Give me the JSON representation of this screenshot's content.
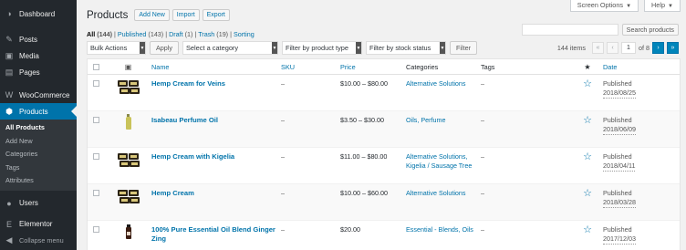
{
  "sidebar": {
    "items": [
      {
        "label": "Dashboard",
        "icon": "dashboard-icon",
        "glyph": "◑"
      },
      {
        "label": "Posts",
        "icon": "pin-icon",
        "glyph": "✎"
      },
      {
        "label": "Media",
        "icon": "media-icon",
        "glyph": "▣"
      },
      {
        "label": "Pages",
        "icon": "pages-icon",
        "glyph": "▤"
      },
      {
        "label": "WooCommerce",
        "icon": "woocommerce-icon",
        "glyph": "W"
      },
      {
        "label": "Products",
        "icon": "products-icon",
        "glyph": "⬢"
      },
      {
        "label": "Users",
        "icon": "users-icon",
        "glyph": "●"
      },
      {
        "label": "Elementor",
        "icon": "elementor-icon",
        "glyph": "E"
      },
      {
        "label": "Collapse menu",
        "icon": "collapse-icon",
        "glyph": "◀"
      }
    ],
    "submenu": [
      "All Products",
      "Add New",
      "Categories",
      "Tags",
      "Attributes"
    ]
  },
  "top_tabs": {
    "screen_options": "Screen Options",
    "help": "Help"
  },
  "header": {
    "title": "Products",
    "add_new": "Add New",
    "import": "Import",
    "export": "Export"
  },
  "views": {
    "all": "All",
    "all_count": "(144)",
    "published": "Published",
    "published_count": "(143)",
    "draft": "Draft",
    "draft_count": "(1)",
    "trash": "Trash",
    "trash_count": "(19)",
    "sorting": "Sorting"
  },
  "search": {
    "button": "Search products"
  },
  "filters": {
    "bulk_actions": "Bulk Actions",
    "apply": "Apply",
    "category": "Select a category",
    "product_type": "Filter by product type",
    "stock_status": "Filter by stock status",
    "filter_button": "Filter"
  },
  "pagination": {
    "items": "144 items",
    "current_page": "1",
    "of_pages": "of 8",
    "first": "«",
    "prev": "‹",
    "next": "›",
    "last": "»"
  },
  "table": {
    "headers": {
      "name": "Name",
      "sku": "SKU",
      "price": "Price",
      "categories": "Categories",
      "tags": "Tags",
      "featured": "★",
      "date": "Date"
    },
    "rows": [
      {
        "name": "Hemp Cream for Veins",
        "sku": "–",
        "price": "$10.00 – $80.00",
        "categories": "Alternative Solutions",
        "tags": "–",
        "status": "Published",
        "date": "2018/08/25"
      },
      {
        "name": "Isabeau Perfume Oil",
        "sku": "–",
        "price": "$3.50 – $30.00",
        "categories": "Oils, Perfume",
        "tags": "–",
        "status": "Published",
        "date": "2018/06/09"
      },
      {
        "name": "Hemp Cream with Kigelia",
        "sku": "–",
        "price": "$11.00 – $80.00",
        "categories": "Alternative Solutions, Kigelia / Sausage Tree",
        "tags": "–",
        "status": "Published",
        "date": "2018/04/11"
      },
      {
        "name": "Hemp Cream",
        "sku": "–",
        "price": "$10.00 – $60.00",
        "categories": "Alternative Solutions",
        "tags": "–",
        "status": "Published",
        "date": "2018/03/28"
      },
      {
        "name": "100% Pure Essential Oil Blend Ginger Zing",
        "sku": "–",
        "price": "$20.00",
        "categories": "Essential - Blends, Oils",
        "tags": "–",
        "status": "Published",
        "date": "2017/12/03"
      }
    ]
  }
}
